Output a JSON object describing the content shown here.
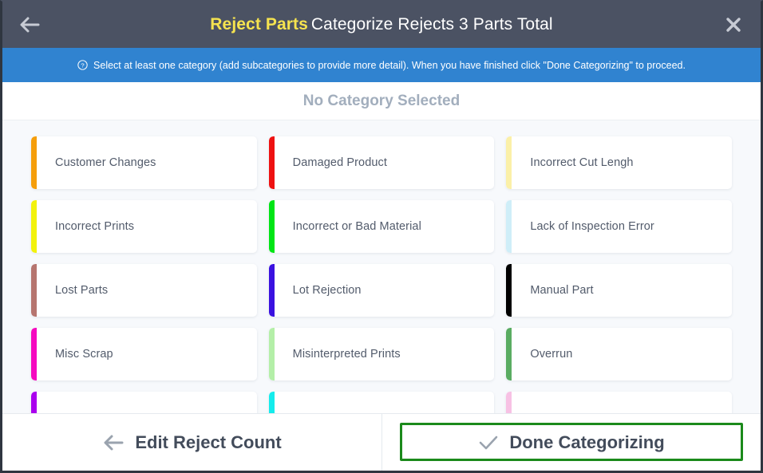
{
  "header": {
    "brand": "Reject Parts",
    "title": "Categorize Rejects 3 Parts Total",
    "back_icon": "arrow-left-icon",
    "close_icon": "close-icon",
    "background_color": "#4b5263",
    "brand_color": "#f5e34f"
  },
  "infobar": {
    "icon": "question-circle-icon",
    "message": "Select at least one category (add subcategories to provide more detail). When you have finished click \"Done Categorizing\" to proceed.",
    "background_color": "#3083d0"
  },
  "selection": {
    "status": "No Category Selected",
    "color": "#a2aebd"
  },
  "categories": [
    {
      "label": "Customer Changes",
      "color": "#f59e0b"
    },
    {
      "label": "Damaged Product",
      "color": "#ee1111"
    },
    {
      "label": "Incorrect Cut Lengh",
      "color": "#fbf0a8"
    },
    {
      "label": "Incorrect Prints",
      "color": "#f2f20d"
    },
    {
      "label": "Incorrect or Bad Material",
      "color": "#00e515"
    },
    {
      "label": "Lack of Inspection Error",
      "color": "#cfeef8"
    },
    {
      "label": "Lost Parts",
      "color": "#b6756f"
    },
    {
      "label": "Lot Rejection",
      "color": "#3a11e0"
    },
    {
      "label": "Manual Part",
      "color": "#000000"
    },
    {
      "label": "Misc Scrap",
      "color": "#f50ac0"
    },
    {
      "label": "Misinterpreted Prints",
      "color": "#b4efa8"
    },
    {
      "label": "Overrun",
      "color": "#5aac62"
    },
    {
      "label": "",
      "color": "#aa00ee"
    },
    {
      "label": "",
      "color": "#14ecec"
    },
    {
      "label": "",
      "color": "#f7c1e4"
    }
  ],
  "footer": {
    "back_icon": "arrow-left-icon",
    "back_label": "Edit Reject Count",
    "done_icon": "check-icon",
    "done_label": "Done Categorizing",
    "highlight_color": "#1b8a1b"
  }
}
